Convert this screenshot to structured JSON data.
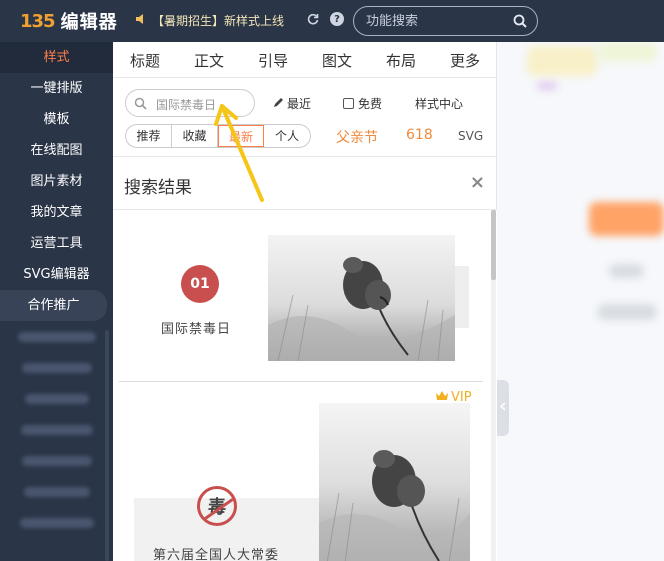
{
  "header": {
    "logo_mark": "135",
    "logo_text": "编辑器",
    "notice": "【暑期招生】新样式上线",
    "search_placeholder": "功能搜索"
  },
  "sidebar": {
    "items": [
      {
        "label": "样式"
      },
      {
        "label": "一键排版"
      },
      {
        "label": "模板"
      },
      {
        "label": "在线配图"
      },
      {
        "label": "图片素材"
      },
      {
        "label": "我的文章"
      },
      {
        "label": "运营工具"
      },
      {
        "label": "SVG编辑器"
      },
      {
        "label": "合作推广"
      }
    ]
  },
  "tabs": [
    "标题",
    "正文",
    "引导",
    "图文",
    "布局",
    "更多"
  ],
  "style_search": {
    "value": "国际禁毒日",
    "recent_label": "最近",
    "free_label": "免费",
    "center_label": "样式中心"
  },
  "filters": {
    "segments": [
      "推荐",
      "收藏",
      "最新",
      "个人"
    ],
    "active_segment": "最新",
    "tags": [
      "父亲节",
      "618",
      "SVG"
    ]
  },
  "results": {
    "title": "搜索结果",
    "close": "×",
    "card1": {
      "number": "01",
      "caption": "国际禁毒日"
    },
    "card2": {
      "vip": "VIP",
      "symbol": "毒",
      "caption": "第六届全国人大常委"
    }
  },
  "colors": {
    "dark_nav": "#2b3548",
    "accent_orange": "#ff7d4a",
    "badge_red": "#c94e4e",
    "vip_gold": "#f0b020",
    "annotation_arrow": "#f5c518"
  }
}
